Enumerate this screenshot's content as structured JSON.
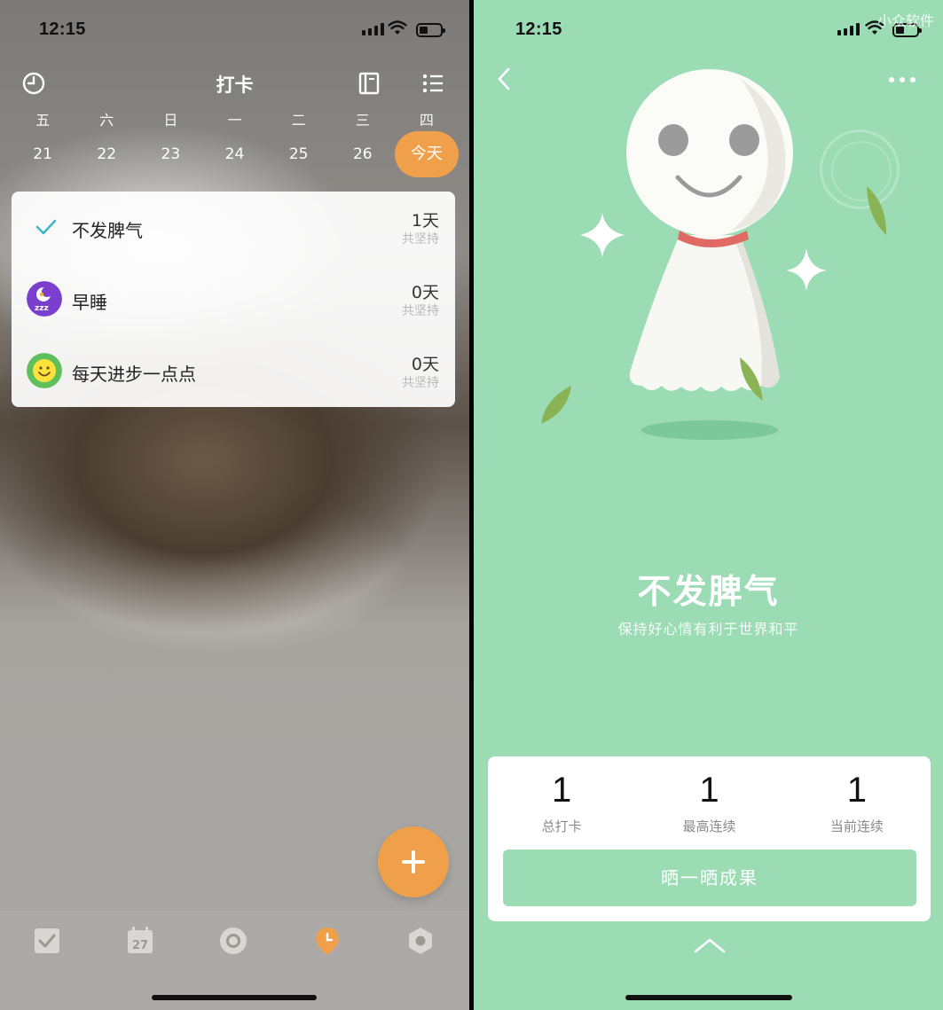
{
  "left": {
    "status": {
      "time": "12:15"
    },
    "nav": {
      "title": "打卡",
      "left_icon": "clock-chart-icon",
      "right_icons": [
        "notebook-icon",
        "list-icon"
      ]
    },
    "week": {
      "days": [
        {
          "name": "五",
          "num": "21"
        },
        {
          "name": "六",
          "num": "22"
        },
        {
          "name": "日",
          "num": "23"
        },
        {
          "name": "一",
          "num": "24"
        },
        {
          "name": "二",
          "num": "25"
        },
        {
          "name": "三",
          "num": "26"
        },
        {
          "name": "四",
          "num": "今天"
        }
      ],
      "today_color": "#f0a04b"
    },
    "habits": [
      {
        "name": "不发脾气",
        "days": "1天",
        "sub": "共坚持",
        "icon": "check-icon",
        "done": true
      },
      {
        "name": "早睡",
        "days": "0天",
        "sub": "共坚持",
        "icon": "sleep-moon-icon",
        "done": false
      },
      {
        "name": "每天进步一点点",
        "days": "0天",
        "sub": "共坚持",
        "icon": "smiley-icon",
        "done": false
      }
    ],
    "tabs": [
      "todo-tab-icon",
      "calendar-tab-icon",
      "focus-tab-icon",
      "checkin-tab-icon",
      "settings-tab-icon"
    ],
    "calendar_day": "27",
    "active_tab_color": "#f0a04b"
  },
  "right": {
    "status": {
      "time": "12:15"
    },
    "watermark": "小众软件",
    "title": "不发脾气",
    "subtitle": "保持好心情有利于世界和平",
    "stats": [
      {
        "value": "1",
        "label": "总打卡"
      },
      {
        "value": "1",
        "label": "最高连续"
      },
      {
        "value": "1",
        "label": "当前连续"
      }
    ],
    "share_label": "晒一晒成果",
    "accent": "#9bdcb4"
  }
}
